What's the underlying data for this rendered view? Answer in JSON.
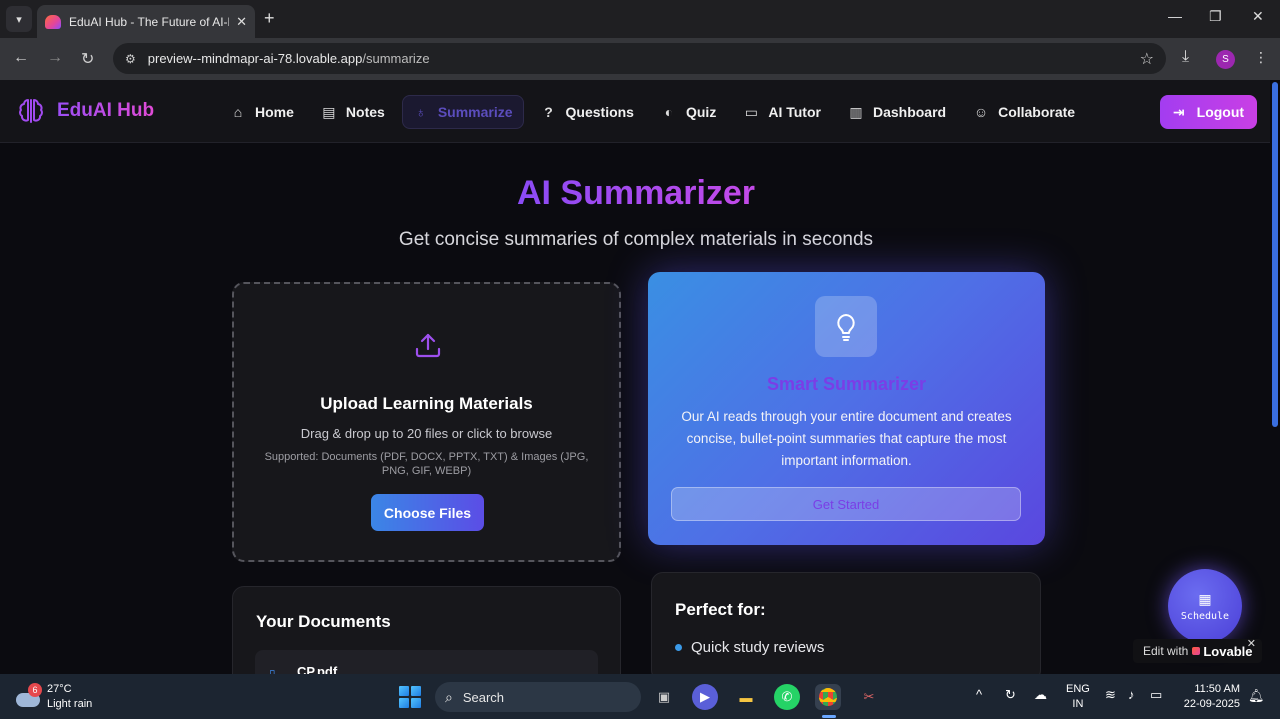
{
  "browser": {
    "tab_title": "EduAI Hub - The Future of AI-Po",
    "url_host": "preview--mindmapr-ai-78.lovable.app",
    "url_path": "/summarize",
    "profile_initial": "S"
  },
  "app": {
    "brand": "EduAI Hub",
    "nav": [
      {
        "label": "Home",
        "icon": "home-icon"
      },
      {
        "label": "Notes",
        "icon": "notes-icon"
      },
      {
        "label": "Summarize",
        "icon": "lightbulb-icon",
        "active": true
      },
      {
        "label": "Questions",
        "icon": "help-circle-icon"
      },
      {
        "label": "Quiz",
        "icon": "quiz-icon"
      },
      {
        "label": "AI Tutor",
        "icon": "chat-icon"
      },
      {
        "label": "Dashboard",
        "icon": "chart-icon"
      },
      {
        "label": "Collaborate",
        "icon": "users-icon"
      }
    ],
    "logout_label": "Logout"
  },
  "main": {
    "title": "AI Summarizer",
    "subtitle": "Get concise summaries of complex materials in seconds"
  },
  "upload": {
    "title": "Upload Learning Materials",
    "description": "Drag & drop up to 20 files or click to browse",
    "supported": "Supported: Documents (PDF, DOCX, PPTX, TXT) & Images (JPG, PNG, GIF, WEBP)",
    "button": "Choose Files"
  },
  "smart": {
    "title": "Smart Summarizer",
    "description": "Our AI reads through your entire document and creates concise, bullet-point summaries that capture the most important information.",
    "button": "Get Started"
  },
  "documents": {
    "title": "Your Documents",
    "items": [
      {
        "name": "CP.pdf"
      }
    ]
  },
  "perfect": {
    "title": "Perfect for:",
    "items": [
      "Quick study reviews"
    ]
  },
  "floating": {
    "schedule_label": "Schedule",
    "edit_with": "Edit with",
    "lovable": "Lovable"
  },
  "taskbar": {
    "weather_badge": "6",
    "temperature": "27°C",
    "condition": "Light rain",
    "search_label": "Search",
    "lang_1": "ENG",
    "lang_2": "IN",
    "time": "11:50 AM",
    "date": "22-09-2025"
  },
  "colors": {
    "accent_purple": "#a33df0",
    "accent_blue": "#3b86e6",
    "page_bg": "#0b0b10"
  }
}
